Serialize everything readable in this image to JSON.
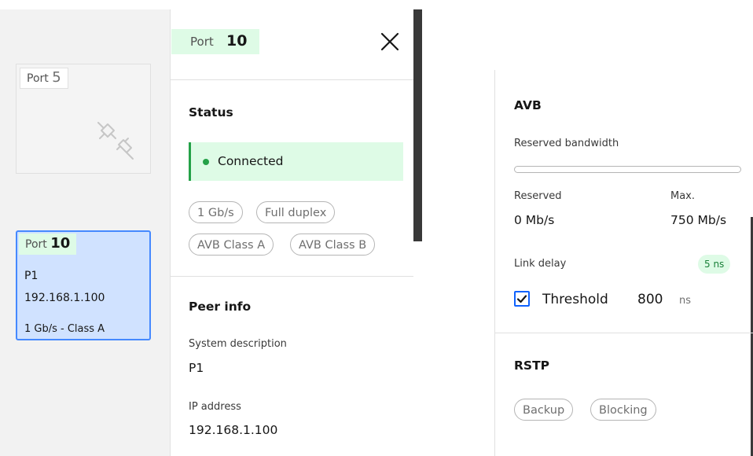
{
  "left_panel": {
    "port5": {
      "prefix": "Port",
      "number": "5"
    },
    "port10": {
      "prefix": "Port",
      "number": "10",
      "name": "P1",
      "ip": "192.168.1.100",
      "speed_class": "1 Gb/s - Class A"
    }
  },
  "detail_panel": {
    "title_prefix": "Port",
    "title_number": "10",
    "status_heading": "Status",
    "status_text": "Connected",
    "tags": [
      "1 Gb/s",
      "Full duplex",
      "AVB Class A",
      "AVB Class B"
    ],
    "peer_heading": "Peer info",
    "system_description_label": "System description",
    "system_description_value": "P1",
    "ip_label": "IP address",
    "ip_value": "192.168.1.100"
  },
  "right_panel": {
    "avb_heading": "AVB",
    "reserved_bandwidth_label": "Reserved bandwidth",
    "reserved_fraction": 0,
    "reserved_label": "Reserved",
    "reserved_value": "0 Mb/s",
    "max_label": "Max.",
    "max_value": "750 Mb/s",
    "link_delay_label": "Link delay",
    "link_delay_badge": "5 ns",
    "threshold_checked": true,
    "threshold_label": "Threshold",
    "threshold_value": "800",
    "threshold_unit": "ns",
    "rstp_heading": "RSTP",
    "rstp_tags": [
      "Backup",
      "Blocking"
    ]
  },
  "colors": {
    "accent_blue": "#4589ff",
    "selected_bg": "#d0e2ff",
    "green_bg": "#defbe6",
    "green_dot": "#24a148",
    "checkbox_blue": "#0f62fe"
  }
}
